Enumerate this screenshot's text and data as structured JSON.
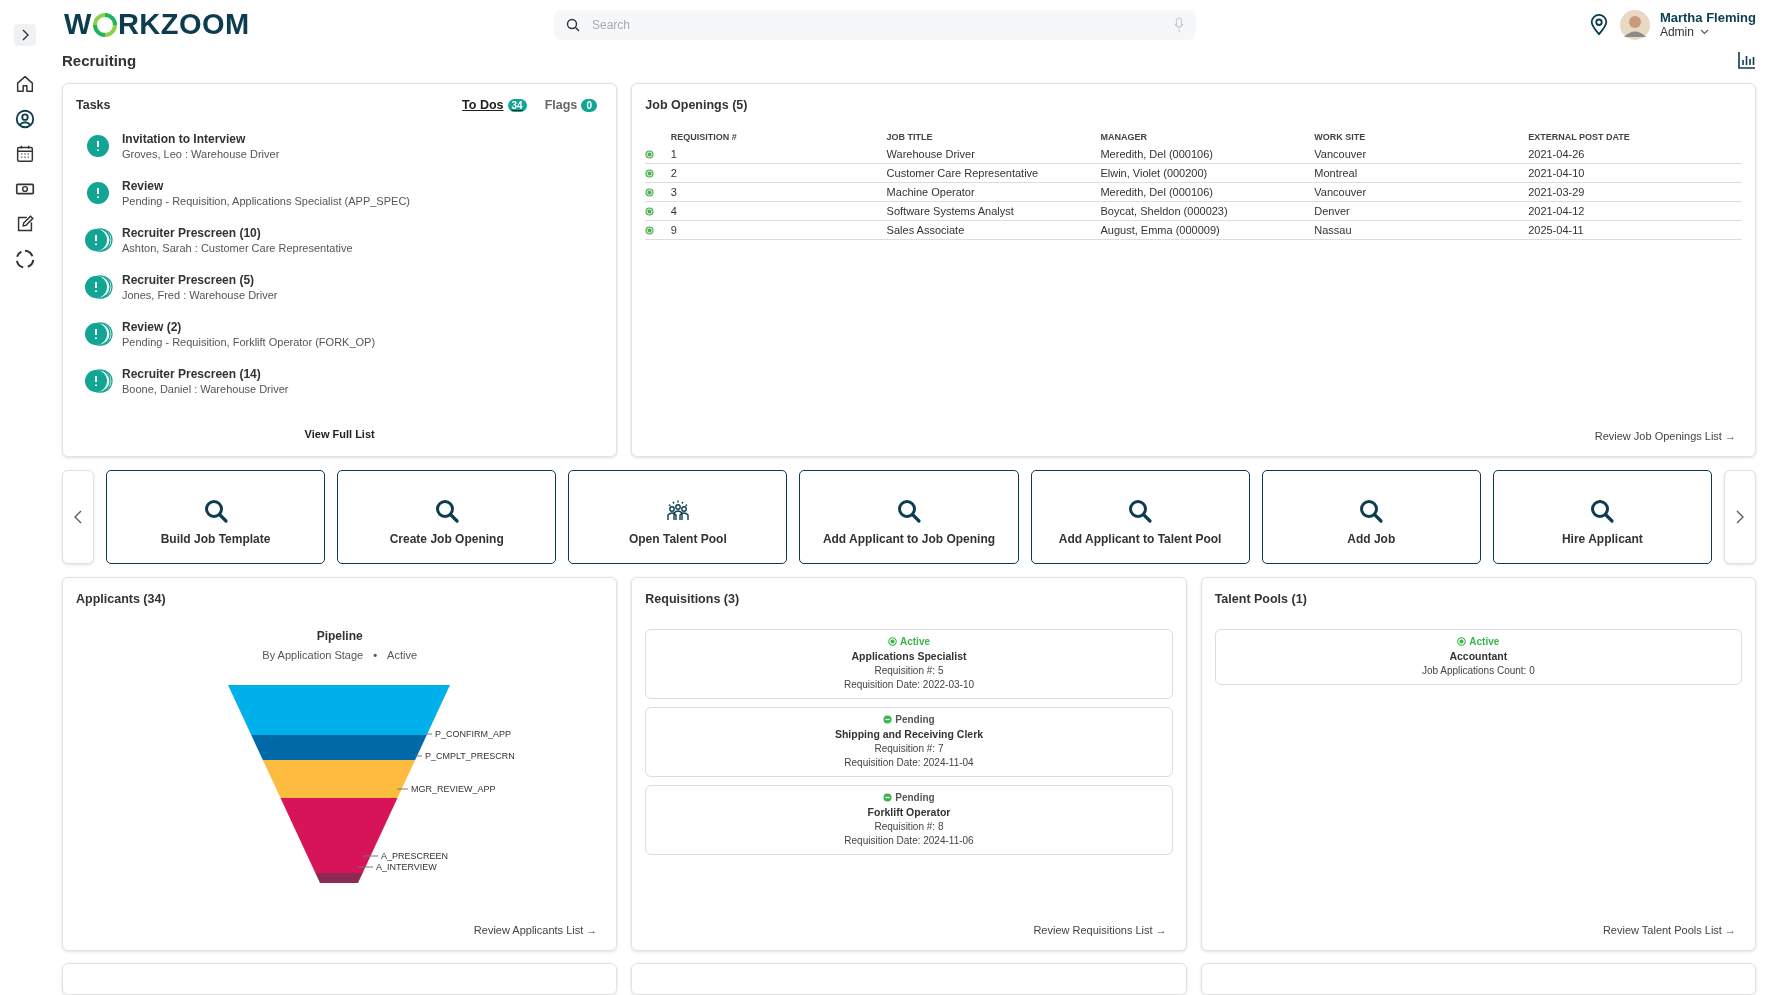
{
  "logo": {
    "before": "W",
    "after": "RKZOOM"
  },
  "search": {
    "placeholder": "Search"
  },
  "user": {
    "name": "Martha Fleming",
    "role": "Admin"
  },
  "page_title": "Recruiting",
  "tasks": {
    "title": "Tasks",
    "tabs": [
      {
        "label": "To Dos",
        "count": "34",
        "selected": true
      },
      {
        "label": "Flags",
        "count": "0",
        "selected": false
      }
    ],
    "items": [
      {
        "title": "Invitation to Interview",
        "detail": "Groves, Leo : Warehouse Driver",
        "kind": "single"
      },
      {
        "title": "Review",
        "detail": "Pending - Requisition, Applications Specialist (APP_SPEC)",
        "kind": "single"
      },
      {
        "title": "Recruiter Prescreen (10)",
        "detail": "Ashton, Sarah : Customer Care Representative",
        "kind": "stacked"
      },
      {
        "title": "Recruiter Prescreen (5)",
        "detail": "Jones, Fred : Warehouse Driver",
        "kind": "stacked"
      },
      {
        "title": "Review (2)",
        "detail": "Pending - Requisition, Forklift Operator (FORK_OP)",
        "kind": "stacked"
      },
      {
        "title": "Recruiter Prescreen (14)",
        "detail": "Boone, Daniel : Warehouse Driver",
        "kind": "stacked"
      }
    ],
    "footer": "View Full List"
  },
  "job_openings": {
    "title": "Job Openings (5)",
    "columns": [
      "REQUISITION #",
      "JOB TITLE",
      "MANAGER",
      "WORK SITE",
      "EXTERNAL POST DATE"
    ],
    "rows": [
      {
        "color": "#4caf50",
        "cells": [
          "1",
          "Warehouse Driver",
          "Meredith, Del (000106)",
          "Vancouver",
          "2021-04-26"
        ]
      },
      {
        "color": "#4caf50",
        "cells": [
          "2",
          "Customer Care Representative",
          "Elwin, Violet (000200)",
          "Montreal",
          "2021-04-10"
        ]
      },
      {
        "color": "#4caf50",
        "cells": [
          "3",
          "Machine Operator",
          "Meredith, Del (000106)",
          "Vancouver",
          "2021-03-29"
        ]
      },
      {
        "color": "#4caf50",
        "cells": [
          "4",
          "Software Systems Analyst",
          "Boycat, Sheldon (000023)",
          "Denver",
          "2021-04-12"
        ]
      },
      {
        "color": "#4caf50",
        "cells": [
          "9",
          "Sales Associate",
          "August, Emma (000009)",
          "Nassau",
          "2025-04-11"
        ]
      }
    ],
    "footer": "Review Job Openings List →"
  },
  "actions": [
    {
      "label": "Build Job Template",
      "kind": "search"
    },
    {
      "label": "Create Job Opening",
      "kind": "search"
    },
    {
      "label": "Open Talent Pool",
      "kind": "people"
    },
    {
      "label": "Add Applicant to Job Opening",
      "kind": "search"
    },
    {
      "label": "Add Applicant to Talent Pool",
      "kind": "search"
    },
    {
      "label": "Add Job",
      "kind": "search"
    },
    {
      "label": "Hire Applicant",
      "kind": "search"
    }
  ],
  "applicants": {
    "title": "Applicants (34)",
    "chart_title": "Pipeline",
    "subtitle": [
      "By Application Stage",
      "Active"
    ],
    "separator": "•",
    "stages": [
      {
        "label": "P_CONFIRM_APP",
        "color": "#00b0ea"
      },
      {
        "label": "P_CMPLT_PRESCRN",
        "color": "#0069a6"
      },
      {
        "label": "MGR_REVIEW_APP",
        "color": "#fdbb40"
      },
      {
        "label": "A_PRESCREEN",
        "color": "#d81458"
      },
      {
        "label": "A_INTERVIEW",
        "color": "#8c2a54"
      }
    ],
    "footer": "Review Applicants List →"
  },
  "requisitions": {
    "title": "Requisitions (3)",
    "items": [
      {
        "status": "Active",
        "active": true,
        "name": "Applications Specialist",
        "lines": [
          "Requisition #: 5",
          "Requisition Date: 2022-03-10"
        ]
      },
      {
        "status": "Pending",
        "active": false,
        "name": "Shipping and Receiving Clerk",
        "lines": [
          "Requisition #: 7",
          "Requisition Date: 2024-11-04"
        ]
      },
      {
        "status": "Pending",
        "active": false,
        "name": "Forklift Operator",
        "lines": [
          "Requisition #: 8",
          "Requisition Date: 2024-11-06"
        ]
      }
    ],
    "footer": "Review Requisitions List →"
  },
  "talent_pools": {
    "title": "Talent Pools (1)",
    "items": [
      {
        "status": "Active",
        "active": true,
        "name": "Accountant",
        "lines": [
          "Job Applications Count: 0"
        ]
      }
    ],
    "footer": "Review Talent Pools List →"
  }
}
